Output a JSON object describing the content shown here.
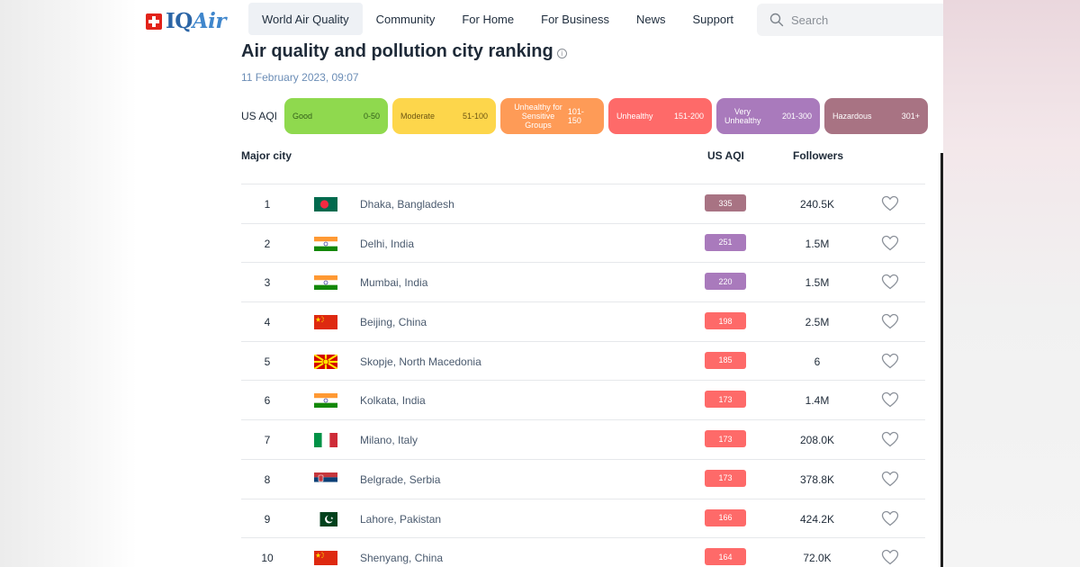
{
  "brand": {
    "name_iq": "IQ",
    "name_air": "Air"
  },
  "nav": {
    "items": [
      "World Air Quality",
      "Community",
      "For Home",
      "For Business",
      "News",
      "Support"
    ],
    "active_index": 0
  },
  "search": {
    "placeholder": "Search"
  },
  "page": {
    "title": "Air quality and pollution city ranking",
    "info_glyph": "i",
    "date": "11 February 2023, 09:07"
  },
  "legend": {
    "label": "US AQI",
    "levels": [
      {
        "name": "Good",
        "range": "0-50",
        "color": "#8fd94e"
      },
      {
        "name": "Moderate",
        "range": "51-100",
        "color": "#fdd64b"
      },
      {
        "name": "Unhealthy for Sensitive Groups",
        "range": "101-150",
        "color": "#fe9b57"
      },
      {
        "name": "Unhealthy",
        "range": "151-200",
        "color": "#fe6a69"
      },
      {
        "name": "Very Unhealthy",
        "range": "201-300",
        "color": "#a97abc"
      },
      {
        "name": "Hazardous",
        "range": "301+",
        "color": "#a87383"
      }
    ]
  },
  "table": {
    "headers": {
      "city": "Major city",
      "aqi": "US AQI",
      "followers": "Followers"
    },
    "rows": [
      {
        "rank": "1",
        "flag": "bangladesh",
        "city": "Dhaka, Bangladesh",
        "aqi": "335",
        "aqi_color": "#a87383",
        "followers": "240.5K"
      },
      {
        "rank": "2",
        "flag": "india",
        "city": "Delhi, India",
        "aqi": "251",
        "aqi_color": "#a97abc",
        "followers": "1.5M"
      },
      {
        "rank": "3",
        "flag": "india",
        "city": "Mumbai, India",
        "aqi": "220",
        "aqi_color": "#a97abc",
        "followers": "1.5M"
      },
      {
        "rank": "4",
        "flag": "china",
        "city": "Beijing, China",
        "aqi": "198",
        "aqi_color": "#fe6a69",
        "followers": "2.5M"
      },
      {
        "rank": "5",
        "flag": "north-macedonia",
        "city": "Skopje, North Macedonia",
        "aqi": "185",
        "aqi_color": "#fe6a69",
        "followers": "6"
      },
      {
        "rank": "6",
        "flag": "india",
        "city": "Kolkata, India",
        "aqi": "173",
        "aqi_color": "#fe6a69",
        "followers": "1.4M"
      },
      {
        "rank": "7",
        "flag": "italy",
        "city": "Milano, Italy",
        "aqi": "173",
        "aqi_color": "#fe6a69",
        "followers": "208.0K"
      },
      {
        "rank": "8",
        "flag": "serbia",
        "city": "Belgrade, Serbia",
        "aqi": "173",
        "aqi_color": "#fe6a69",
        "followers": "378.8K"
      },
      {
        "rank": "9",
        "flag": "pakistan",
        "city": "Lahore, Pakistan",
        "aqi": "166",
        "aqi_color": "#fe6a69",
        "followers": "424.2K"
      },
      {
        "rank": "10",
        "flag": "china",
        "city": "Shenyang, China",
        "aqi": "164",
        "aqi_color": "#fe6a69",
        "followers": "72.0K"
      }
    ]
  }
}
